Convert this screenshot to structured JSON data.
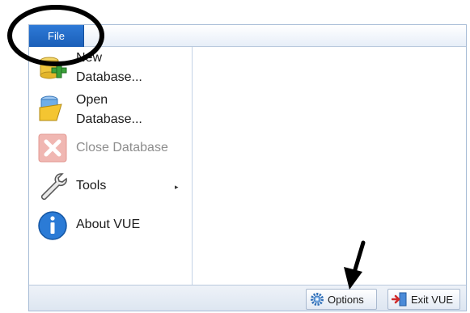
{
  "ribbon": {
    "file_tab": "File"
  },
  "menu": {
    "items": [
      {
        "label": "New\nDatabase...",
        "icon": "new-database-icon",
        "enabled": true
      },
      {
        "label": "Open\nDatabase...",
        "icon": "open-database-icon",
        "enabled": true
      },
      {
        "label": "Close Database",
        "icon": "close-database-icon",
        "enabled": false
      },
      {
        "label": "Tools",
        "icon": "wrench-icon",
        "enabled": true,
        "has_submenu": true,
        "submenu_glyph": "▸"
      },
      {
        "label": "About VUE",
        "icon": "info-icon",
        "enabled": true
      }
    ]
  },
  "footer": {
    "options_label": "Options",
    "exit_label": "Exit VUE"
  },
  "colors": {
    "file_tab": "#1f67c2",
    "annotation": "#000000",
    "frame_border": "#a7bcd6"
  }
}
